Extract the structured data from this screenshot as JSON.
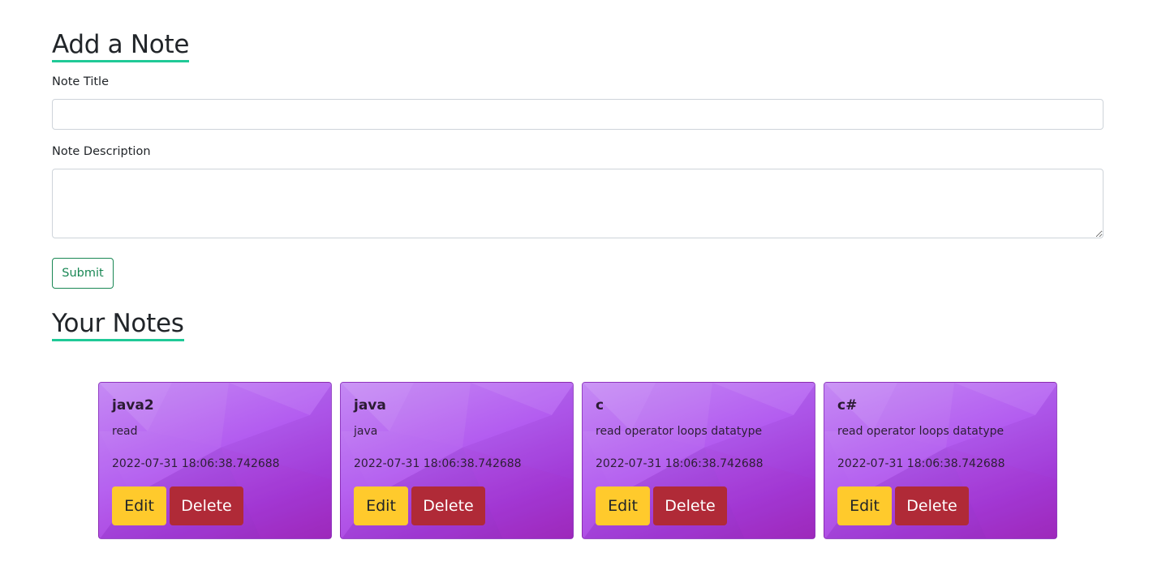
{
  "add_section": {
    "heading": "Add a Note",
    "title_label": "Note Title",
    "title_value": "",
    "desc_label": "Note Description",
    "desc_value": "",
    "submit_label": "Submit"
  },
  "notes_section": {
    "heading": "Your Notes",
    "edit_label": "Edit",
    "delete_label": "Delete",
    "notes": [
      {
        "title": "java2",
        "description": "read",
        "timestamp": "2022-07-31 18:06:38.742688"
      },
      {
        "title": "java",
        "description": "java",
        "timestamp": "2022-07-31 18:06:38.742688"
      },
      {
        "title": "c",
        "description": "read operator loops datatype",
        "timestamp": "2022-07-31 18:06:38.742688"
      },
      {
        "title": "c#",
        "description": "read operator loops datatype",
        "timestamp": "2022-07-31 18:06:38.742688"
      }
    ]
  },
  "colors": {
    "accent_underline": "#20c997",
    "submit_outline": "#198754",
    "edit_button": "#ffca2c",
    "delete_button": "#b02a37",
    "card_purple": "#b35cf0"
  }
}
